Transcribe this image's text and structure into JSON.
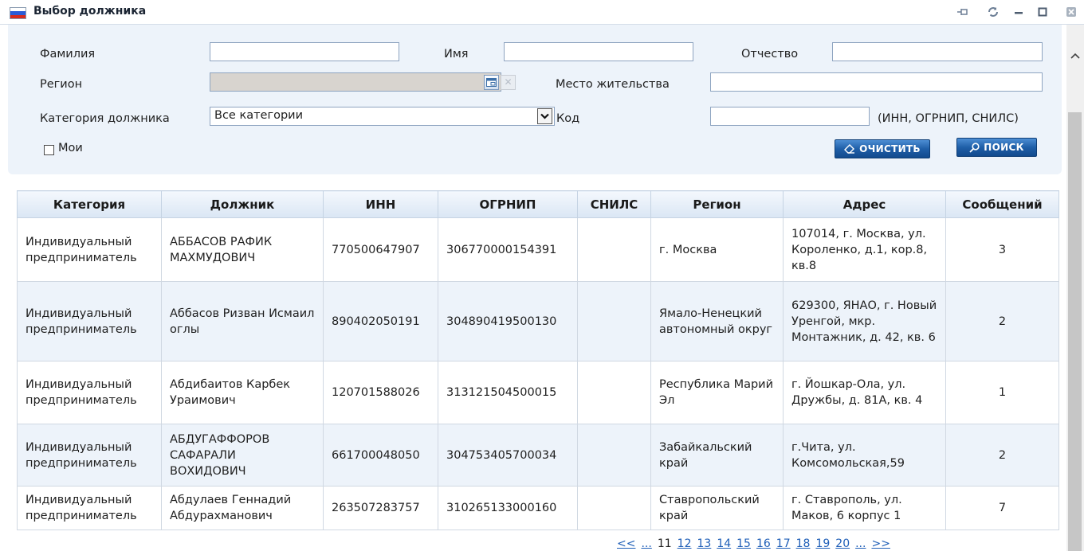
{
  "window": {
    "title": "Выбор должника",
    "flag_colors": [
      "#ffffff",
      "#2a5bd7",
      "#d52b1e"
    ]
  },
  "filters": {
    "surname_label": "Фамилия",
    "surname_value": "",
    "name_label": "Имя",
    "name_value": "",
    "patronymic_label": "Отчество",
    "patronymic_value": "",
    "region_label": "Регион",
    "region_value": "",
    "residence_label": "Место жительства",
    "residence_value": "",
    "category_label": "Категория должника",
    "category_value": "Все категории",
    "code_label": "Код",
    "code_value": "",
    "code_hint": "(ИНН, ОГРНИП, СНИЛС)",
    "mine_label": "Мои",
    "mine_checked": false,
    "clear_button": "ОЧИСТИТЬ",
    "search_button": "ПОИСК"
  },
  "table": {
    "columns": [
      "Категория",
      "Должник",
      "ИНН",
      "ОГРНИП",
      "СНИЛС",
      "Регион",
      "Адрес",
      "Сообщений"
    ],
    "rows": [
      {
        "category": "Индивидуальный предприниматель",
        "debtor": "АББАСОВ РАФИК МАХМУДОВИЧ",
        "inn": "770500647907",
        "ogrnip": "306770000154391",
        "snils": "",
        "region": "г. Москва",
        "address": "107014, г. Москва, ул. Короленко, д.1, кор.8, кв.8",
        "messages": "3"
      },
      {
        "category": "Индивидуальный предприниматель",
        "debtor": "Аббасов Ризван Исмаил оглы",
        "inn": "890402050191",
        "ogrnip": "304890419500130",
        "snils": "",
        "region": "Ямало-Ненецкий автономный округ",
        "address": "629300, ЯНАО, г. Новый Уренгой, мкр. Монтажник, д. 42, кв. 6",
        "messages": "2"
      },
      {
        "category": "Индивидуальный предприниматель",
        "debtor": "Абдибаитов Карбек Ураимович",
        "inn": "120701588026",
        "ogrnip": "313121504500015",
        "snils": "",
        "region": "Республика Марий Эл",
        "address": "г. Йошкар-Ола, ул. Дружбы, д. 81А, кв. 4",
        "messages": "1"
      },
      {
        "category": "Индивидуальный предприниматель",
        "debtor": "АБДУГАФФОРОВ САФАРАЛИ ВОХИДОВИЧ",
        "inn": "661700048050",
        "ogrnip": "304753405700034",
        "snils": "",
        "region": "Забайкальский край",
        "address": "г.Чита, ул. Комсомольская,59",
        "messages": "2"
      },
      {
        "category": "Индивидуальный предприниматель",
        "debtor": "Абдулаев Геннадий Абдурахманович",
        "inn": "263507283757",
        "ogrnip": "310265133000160",
        "snils": "",
        "region": "Ставропольский край",
        "address": "г. Ставрополь, ул. Маков, 6 корпус 1",
        "messages": "7"
      }
    ]
  },
  "pager": {
    "first": "<<",
    "prev_more": "...",
    "current": "11",
    "pages": [
      "12",
      "13",
      "14",
      "15",
      "16",
      "17",
      "18",
      "19",
      "20"
    ],
    "next_more": "...",
    "last": ">>"
  }
}
